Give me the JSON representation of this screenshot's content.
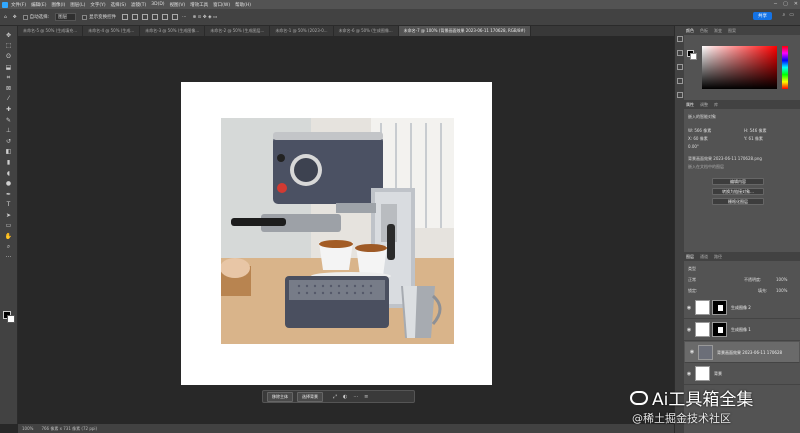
{
  "menubar": {
    "items": [
      "文件(F)",
      "编辑(E)",
      "图像(I)",
      "图层(L)",
      "文字(Y)",
      "选择(S)",
      "滤镜(T)",
      "3D(D)",
      "视图(V)",
      "增效工具",
      "窗口(W)",
      "帮助(H)"
    ]
  },
  "options": {
    "auto_select_label": "自动选择:",
    "auto_select_value": "图层",
    "transform_label": "显示变换控件",
    "share_label": "共享"
  },
  "tabs": [
    {
      "label": "未命名-5 @ 50% (生成填充...",
      "active": false
    },
    {
      "label": "未命名-4 @ 50% (生成...",
      "active": false
    },
    {
      "label": "未命名-3 @ 50% (生成图像...",
      "active": false
    },
    {
      "label": "未命名-2 @ 50% (生成图层...",
      "active": false
    },
    {
      "label": "未命名-1 @ 50% (2023-0...",
      "active": false
    },
    {
      "label": "未命名-6 @ 50% (生成图像...",
      "active": false
    },
    {
      "label": "未命名-7 @ 100% (背景画面效果 2023-06-11 170628, RGB/8#)",
      "active": true
    }
  ],
  "context_bar": {
    "remove_bg": "移除主体",
    "select_subject": "选择背景"
  },
  "statusbar": {
    "zoom": "100%",
    "info": "766 像素 x 731 像素 (72 ppi)"
  },
  "right_panel": {
    "color_tabs": [
      "颜色",
      "色板",
      "渐变",
      "图案"
    ],
    "props_tabs": [
      "属性",
      "调整",
      "库"
    ],
    "props_title": "嵌入的智能对象",
    "w_label": "W: 566 像素",
    "h_label": "H: 546 像素",
    "x_label": "X: 60 像素",
    "y_label": "Y: 61 像素",
    "angle": "0.00°",
    "file_name": "背景画面效果 2023-06-11 170628.png",
    "file_sub": "嵌入在文档中的图层",
    "btn_edit": "编辑内容",
    "btn_convert": "转换为链接对象...",
    "btn_rasterize": "栅格化图层"
  },
  "layers_panel": {
    "tabs": [
      "图层",
      "通道",
      "路径"
    ],
    "kind_label": "类型",
    "blend_mode": "正常",
    "opacity_label": "不透明度:",
    "opacity_value": "100%",
    "lock_label": "锁定:",
    "fill_label": "填充:",
    "fill_value": "100%",
    "layers": [
      {
        "name": "生成图像 2",
        "has_mask": true,
        "selected": false
      },
      {
        "name": "生成图像 1",
        "has_mask": true,
        "selected": false
      },
      {
        "name": "背景画面效果 2023-06-11 170628",
        "has_mask": false,
        "selected": true
      },
      {
        "name": "背景",
        "has_mask": false,
        "selected": false
      }
    ]
  },
  "watermark": {
    "line1": "Ai工具箱全集",
    "line2": "@稀土掘金技术社区"
  }
}
